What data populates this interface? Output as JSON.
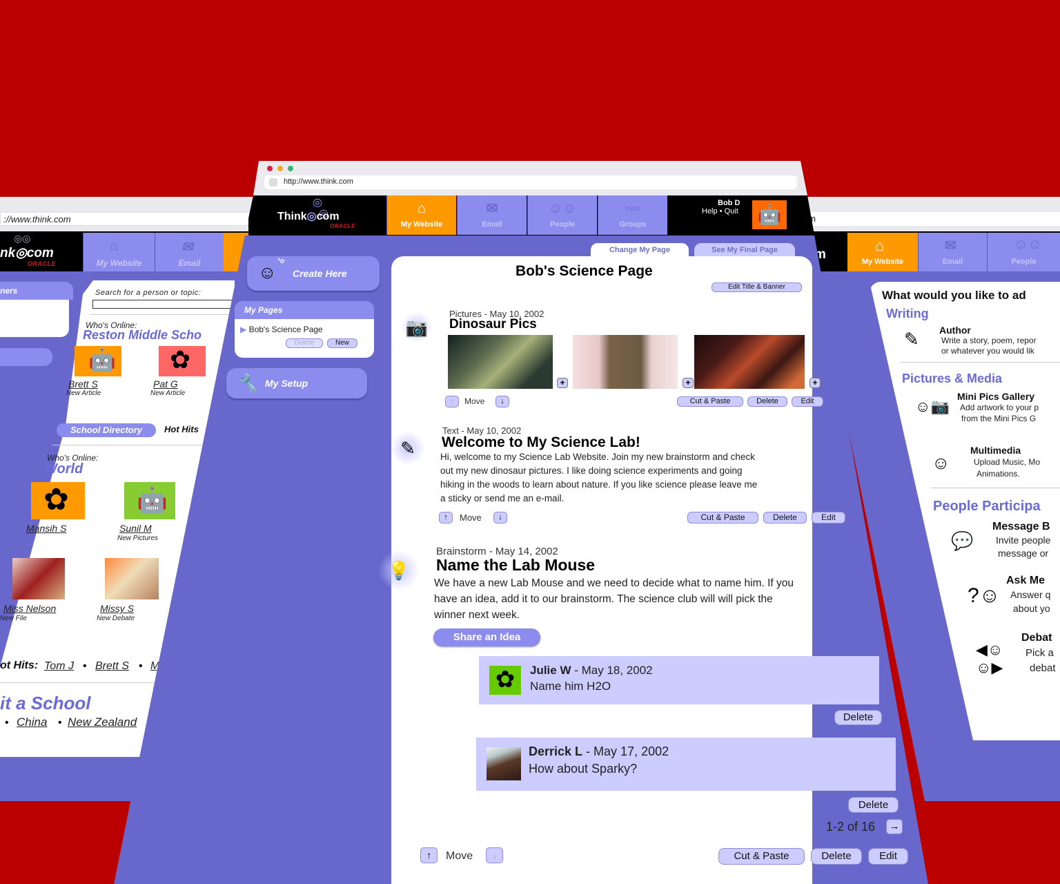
{
  "colors": {
    "background": "#bb0000",
    "app_purple": "#6868cc",
    "tab_purple": "#8c8cee",
    "active_tab": "#ff9900",
    "comment_bg": "#ccccff",
    "heading_blue": "#6a6ad8",
    "oracle_red": "#e01818"
  },
  "browser": {
    "url": "http://www.think.com"
  },
  "brand": {
    "logo_text_left": "Think",
    "logo_text_right": "com",
    "oracle": "ORACLE"
  },
  "nav": {
    "tabs": [
      {
        "label": "My Website",
        "icon": "house-icon",
        "active": true
      },
      {
        "label": "Email",
        "icon": "envelope-icon",
        "active": false
      },
      {
        "label": "People",
        "icon": "people-icon",
        "active": false
      },
      {
        "label": "Groups",
        "icon": "groups-icon",
        "active": false
      }
    ],
    "user_name": "Bob D",
    "help": "Help",
    "separator": "•",
    "quit": "Quit",
    "user_avatar": "robot-avatar-icon"
  },
  "sidebar": {
    "create_here": "Create Here",
    "my_pages_title": "My Pages",
    "pages": [
      "Bob's Science Page"
    ],
    "delete_label": "Delete",
    "new_label": "New",
    "my_setup": "My Setup"
  },
  "content_tabs": {
    "change": "Change My Page",
    "final": "See My Final Page"
  },
  "page": {
    "title": "Bob's Science Page",
    "edit_title_banner": "Edit Title & Banner"
  },
  "sections": [
    {
      "type": "Pictures",
      "date": "May 10, 2002",
      "title": "Dinosaur Pics",
      "icon": "camera-icon",
      "photos": [
        "dinosaur-photo-1",
        "dinosaur-photo-2",
        "dinosaur-photo-3"
      ],
      "move": "Move",
      "actions": [
        "Cut & Paste",
        "Delete",
        "Edit"
      ]
    },
    {
      "type": "Text",
      "date": "May 10, 2002",
      "title": "Welcome to My Science Lab!",
      "icon": "pencil-icon",
      "body_lines": [
        "Hi, welcome to my Science Lab Website.  Join my new brainstorm and check",
        "out my new dinosaur pictures.  I like doing science experiments and going",
        "hiking in the woods to learn about nature.  If you like science please leave me",
        "a sticky or send me an e-mail."
      ],
      "move": "Move",
      "actions": [
        "Cut & Paste",
        "Delete",
        "Edit"
      ]
    },
    {
      "type": "Brainstorm",
      "date": "May 14, 2002",
      "title": "Name the Lab Mouse",
      "icon": "lightbulb-icon",
      "body_lines": [
        "We have a new Lab Mouse and we need to decide what to name him.  If you",
        "have an idea, add it to our brainstorm.  The science club will will pick the",
        "winner next week."
      ],
      "share_idea": "Share an Idea",
      "comments": [
        {
          "author": "Julie W",
          "date": "May 18, 2002",
          "text": "Name him H2O",
          "delete": "Delete"
        },
        {
          "author": "Derrick L",
          "date": "May 17, 2002",
          "text": "How about Sparky?",
          "delete": "Delete"
        }
      ],
      "pagination": "1-2 of 16",
      "move": "Move",
      "actions": [
        "Cut & Paste",
        "Delete",
        "Edit"
      ]
    }
  ],
  "left_window": {
    "url": "://www.think.com",
    "tabs": [
      "My Website",
      "Email"
    ],
    "panel_head_1": "ners",
    "search_label": "Search for a person or topic:",
    "search_value": "",
    "whos_online_1": "Who's Online:",
    "school": "Reston Middle Scho",
    "school_users": [
      {
        "name": "Brett S",
        "caption": "New Article"
      },
      {
        "name": "Pat G",
        "caption": "New Article"
      }
    ],
    "school_directory": "School Directory",
    "hot_hits_tab": "Hot Hits",
    "whos_online_2": "Who's Online:",
    "world": "World",
    "world_users": [
      {
        "name": "Mansih S",
        "caption": ""
      },
      {
        "name": "Sunil M",
        "caption": "New Pictures"
      },
      {
        "name": "Miss Nelson",
        "caption": "New File"
      },
      {
        "name": "Missy S",
        "caption": "New Debate"
      }
    ],
    "hot_hits_label": "ot Hits:",
    "hot_hits": [
      "Tom J",
      "Brett S",
      "M"
    ],
    "visit_school": "it a School",
    "countries": [
      "China",
      "New Zealand"
    ]
  },
  "right_window": {
    "url": "om",
    "tabs": [
      "My Website",
      "Email",
      "People"
    ],
    "question": "What would you like to ad",
    "groups": [
      {
        "heading": "Writing",
        "items": [
          {
            "title": "Author",
            "icon": "pencil-icon",
            "desc": [
              "Write a story, poem, repor",
              " or whatever you would lik"
            ]
          }
        ]
      },
      {
        "heading": "Pictures & Media",
        "items": [
          {
            "title": "Mini Pics Gallery",
            "icon": "camera-face-icon",
            "desc": [
              "Add artwork to your p",
              "from the Mini Pics G"
            ]
          },
          {
            "title": "Multimedia",
            "icon": "headphones-face-icon",
            "desc": [
              "Upload Music, Mo",
              "Animations."
            ]
          }
        ]
      },
      {
        "heading": "People Participa",
        "items": [
          {
            "title": "Message B",
            "icon": "speech-bubble-icon",
            "desc": [
              "Invite people",
              "message or"
            ]
          },
          {
            "title": "Ask Me",
            "icon": "question-face-icon",
            "desc": [
              "Answer q",
              "about yo"
            ]
          },
          {
            "title": "Debat",
            "icon": "debate-faces-icon",
            "desc": [
              "Pick a",
              "debat"
            ]
          }
        ]
      }
    ]
  }
}
